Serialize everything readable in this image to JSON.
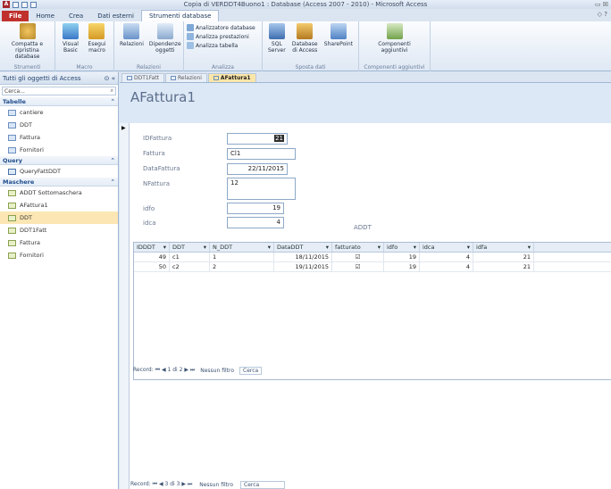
{
  "window": {
    "title": "Copia di VERDDT4Buono1 : Database (Access 2007 - 2010) - Microsoft Access",
    "app_letter": "A"
  },
  "ribbon_tabs": [
    {
      "label": "File",
      "kind": "file"
    },
    {
      "label": "Home",
      "kind": "normal"
    },
    {
      "label": "Crea",
      "kind": "normal"
    },
    {
      "label": "Dati esterni",
      "kind": "normal"
    },
    {
      "label": "Strumenti database",
      "kind": "active"
    }
  ],
  "ribbon": {
    "groups": {
      "strumenti": {
        "label": "Strumenti",
        "btn": "Compatta e ripristina database"
      },
      "macro": {
        "label": "Macro",
        "btn1": "Visual Basic",
        "btn2": "Esegui macro"
      },
      "relazioni": {
        "label": "Relazioni",
        "btn1": "Relazioni",
        "btn2": "Dipendenze oggetti"
      },
      "analizza": {
        "label": "Analizza",
        "items": [
          "Analizzatore database",
          "Analizza prestazioni",
          "Analizza tabella"
        ]
      },
      "sposta": {
        "label": "Sposta dati",
        "btn1": "SQL Server",
        "btn2": "Database di Access",
        "btn3": "SharePoint"
      },
      "componenti": {
        "label": "Componenti aggiuntivi",
        "btn": "Componenti aggiuntivi"
      }
    }
  },
  "nav": {
    "header": "Tutti gli oggetti di Access",
    "search_placeholder": "Cerca...",
    "sections": [
      {
        "title": "Tabelle",
        "items": [
          "cantiere",
          "DDT",
          "Fattura",
          "Fornitori"
        ]
      },
      {
        "title": "Query",
        "items": [
          "QueryFattDDT"
        ]
      },
      {
        "title": "Maschere",
        "items": [
          "ADDT Sottomaschera",
          "AFattura1",
          "DDT",
          "DDT1Fatt",
          "Fattura",
          "Fornitori"
        ]
      }
    ],
    "selected_item": "DDT"
  },
  "doc_tabs": [
    "DDT1Fatt",
    "Relazioni",
    "AFattura1"
  ],
  "form": {
    "title": "AFattura1",
    "fields": {
      "idfattura": {
        "label": "IDFattura",
        "value": "21"
      },
      "fattura": {
        "label": "Fattura",
        "value": "Cl1"
      },
      "datafattura": {
        "label": "DataFattura",
        "value": "22/11/2015"
      },
      "nfattura": {
        "label": "NFattura",
        "value": "12"
      },
      "idfo": {
        "label": "idfo",
        "value": "19"
      },
      "idca": {
        "label": "idca",
        "value": "4"
      }
    },
    "subform_label": "ADDT"
  },
  "subform": {
    "columns": [
      "IDDDT",
      "DDT",
      "N_DDT",
      "DataDDT",
      "fatturato",
      "idfo",
      "idca",
      "idfa"
    ],
    "rows": [
      {
        "IDDDT": "49",
        "DDT": "c1",
        "N_DDT": "1",
        "DataDDT": "18/11/2015",
        "fatturato": "☑",
        "idfo": "19",
        "idca": "4",
        "idfa": "21"
      },
      {
        "IDDDT": "50",
        "DDT": "c2",
        "N_DDT": "2",
        "DataDDT": "19/11/2015",
        "fatturato": "☑",
        "idfo": "19",
        "idca": "4",
        "idfa": "21"
      }
    ],
    "nav": {
      "record": "Record: ⏮ ◀ 1 di 2 ▶ ⏭",
      "filter": "Nessun filtro",
      "search": "Cerca"
    }
  },
  "main_nav": {
    "record": "Record: ⏮ ◀ 3 di 3 ▶ ⏭",
    "filter": "Nessun filtro",
    "search": "Cerca"
  }
}
